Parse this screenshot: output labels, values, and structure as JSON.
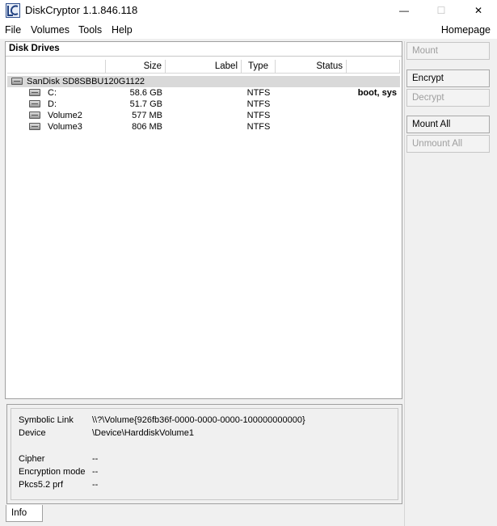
{
  "window": {
    "title": "DiskCryptor 1.1.846.118",
    "min_glyph": "—",
    "max_glyph": "☐",
    "close_glyph": "✕"
  },
  "menu": {
    "items": [
      "File",
      "Volumes",
      "Tools",
      "Help"
    ],
    "homepage": "Homepage"
  },
  "drives_panel": {
    "title": "Disk Drives",
    "columns": {
      "size": "Size",
      "label": "Label",
      "type": "Type",
      "status": "Status"
    },
    "disk": {
      "name": "SanDisk SD8SBBU120G1122"
    },
    "volumes": [
      {
        "name": "C:",
        "size": "58.6 GB",
        "label": "",
        "type": "NTFS",
        "status": "boot, sys"
      },
      {
        "name": "D:",
        "size": "51.7 GB",
        "label": "",
        "type": "NTFS",
        "status": ""
      },
      {
        "name": "Volume2",
        "size": "577 MB",
        "label": "",
        "type": "NTFS",
        "status": ""
      },
      {
        "name": "Volume3",
        "size": "806 MB",
        "label": "",
        "type": "NTFS",
        "status": ""
      }
    ]
  },
  "info": {
    "symbolic_link_label": "Symbolic Link",
    "symbolic_link_value": "\\\\?\\Volume{926fb36f-0000-0000-0000-100000000000}",
    "device_label": "Device",
    "device_value": "\\Device\\HarddiskVolume1",
    "cipher_label": "Cipher",
    "cipher_value": "--",
    "encryption_mode_label": "Encryption mode",
    "encryption_mode_value": "--",
    "pkcs_label": "Pkcs5.2 prf",
    "pkcs_value": "--"
  },
  "tabs": {
    "info": "Info"
  },
  "buttons": {
    "mount": "Mount",
    "encrypt": "Encrypt",
    "decrypt": "Decrypt",
    "mount_all": "Mount All",
    "unmount_all": "Unmount All"
  },
  "colors": {
    "disk_row_bg": "#d9d9d9",
    "disabled_text": "#9e9e9e"
  }
}
